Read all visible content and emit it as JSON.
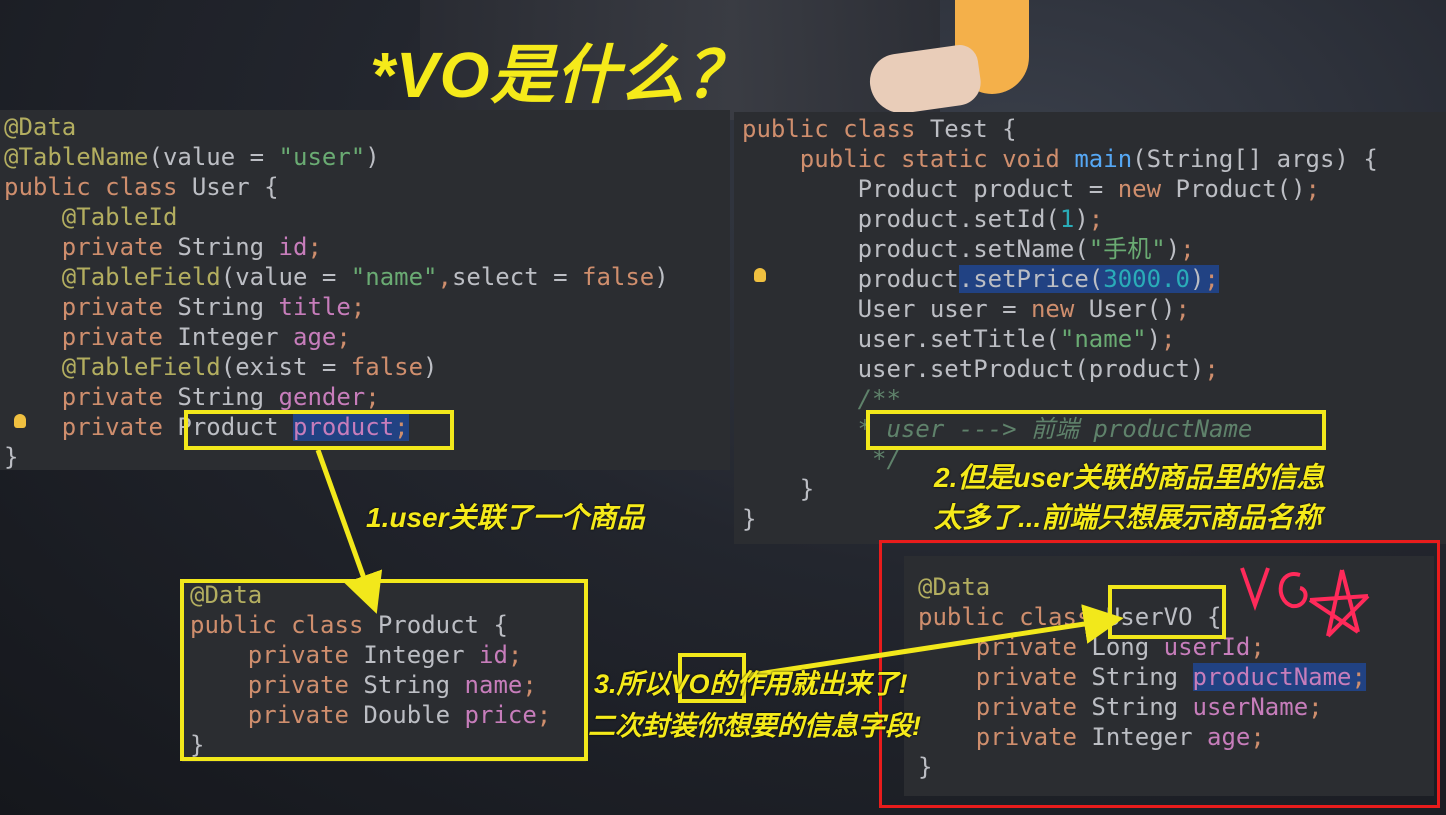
{
  "title": "*VO是什么？",
  "panel_user": {
    "lines": [
      [
        [
          "an",
          "@Data"
        ]
      ],
      [
        [
          "an",
          "@TableName"
        ],
        [
          "",
          "(value = "
        ],
        [
          "str",
          "\"user\""
        ],
        [
          "",
          ")"
        ]
      ],
      [
        [
          "kw",
          "public class"
        ],
        [
          "",
          " User {"
        ]
      ],
      [
        [
          "",
          ""
        ],
        [
          "an",
          "    @TableId"
        ]
      ],
      [
        [
          "kw",
          "    private"
        ],
        [
          "",
          " String "
        ],
        [
          "fld",
          "id"
        ],
        [
          "kw",
          ";"
        ]
      ],
      [
        [
          "an",
          "    @TableField"
        ],
        [
          "",
          "(value = "
        ],
        [
          "str",
          "\"name\""
        ],
        [
          "kw",
          ","
        ],
        [
          "",
          "select = "
        ],
        [
          "kw",
          "false"
        ],
        [
          "",
          ")"
        ]
      ],
      [
        [
          "kw",
          "    private"
        ],
        [
          "",
          " String "
        ],
        [
          "fld",
          "title"
        ],
        [
          "kw",
          ";"
        ]
      ],
      [
        [
          "kw",
          "    private"
        ],
        [
          "",
          " Integer "
        ],
        [
          "fld",
          "age"
        ],
        [
          "kw",
          ";"
        ]
      ],
      [
        [
          "an",
          "    @TableField"
        ],
        [
          "",
          "(exist = "
        ],
        [
          "kw",
          "false"
        ],
        [
          "",
          ")"
        ]
      ],
      [
        [
          "kw",
          "    private"
        ],
        [
          "",
          " String "
        ],
        [
          "fld",
          "gender"
        ],
        [
          "kw",
          ";"
        ]
      ],
      [
        [
          "kw",
          "    private"
        ],
        [
          "",
          " Product "
        ],
        [
          "fld sel",
          "product"
        ],
        [
          "kw sel",
          ";"
        ]
      ],
      [
        [
          "",
          "}"
        ]
      ]
    ]
  },
  "panel_test": {
    "lines": [
      [
        [
          "kw",
          "public class"
        ],
        [
          "",
          " Test {"
        ]
      ],
      [
        [
          "kw",
          "    public static void"
        ],
        [
          "",
          " "
        ],
        [
          "fn",
          "main"
        ],
        [
          "",
          "(String[] args) {"
        ]
      ],
      [
        [
          "",
          "        Product product = "
        ],
        [
          "kw",
          "new"
        ],
        [
          "",
          " Product()"
        ],
        [
          "kw",
          ";"
        ]
      ],
      [
        [
          "",
          "        product.setId("
        ],
        [
          "num",
          "1"
        ],
        [
          "",
          ")"
        ],
        [
          "kw",
          ";"
        ]
      ],
      [
        [
          "",
          "        product.setName("
        ],
        [
          "str",
          "\"手机\""
        ],
        [
          "",
          ")"
        ],
        [
          "kw",
          ";"
        ]
      ],
      [
        [
          "",
          "        product"
        ],
        [
          "sel",
          ".setPrice("
        ],
        [
          "num sel",
          "3000.0"
        ],
        [
          "sel",
          ")"
        ],
        [
          "kw sel",
          ";"
        ]
      ],
      [
        [
          "",
          "        User user = "
        ],
        [
          "kw",
          "new"
        ],
        [
          "",
          " User()"
        ],
        [
          "kw",
          ";"
        ]
      ],
      [
        [
          "",
          "        user.setTitle("
        ],
        [
          "str",
          "\"name\""
        ],
        [
          "",
          ")"
        ],
        [
          "kw",
          ";"
        ]
      ],
      [
        [
          "",
          "        user.setProduct(product)"
        ],
        [
          "kw",
          ";"
        ]
      ],
      [
        [
          "cm",
          "        /**"
        ]
      ],
      [
        [
          "cm",
          "        * user ---> "
        ],
        [
          "cm",
          "前端"
        ],
        [
          "cm",
          " productName"
        ]
      ],
      [
        [
          "cm",
          "         */"
        ]
      ],
      [
        [
          "",
          "    }"
        ]
      ],
      [
        [
          "",
          "}"
        ]
      ]
    ]
  },
  "panel_product": {
    "lines": [
      [
        [
          "an",
          "@Data"
        ]
      ],
      [
        [
          "kw",
          "public"
        ],
        [
          "kw",
          " class"
        ],
        [
          "",
          " Product {"
        ]
      ],
      [
        [
          "kw",
          "    private"
        ],
        [
          "",
          " Integer "
        ],
        [
          "fld",
          "id"
        ],
        [
          "kw",
          ";"
        ]
      ],
      [
        [
          "kw",
          "    private"
        ],
        [
          "",
          " String "
        ],
        [
          "fld",
          "name"
        ],
        [
          "kw",
          ";"
        ]
      ],
      [
        [
          "kw",
          "    private"
        ],
        [
          "",
          " Double "
        ],
        [
          "fld",
          "price"
        ],
        [
          "kw",
          ";"
        ]
      ],
      [
        [
          "",
          "}"
        ]
      ]
    ]
  },
  "panel_uservo": {
    "lines": [
      [
        [
          "an",
          "@Data"
        ]
      ],
      [
        [
          "kw",
          "public class"
        ],
        [
          "",
          " UserVO {"
        ]
      ],
      [
        [
          "kw",
          "    private"
        ],
        [
          "",
          " Long "
        ],
        [
          "fld",
          "userId"
        ],
        [
          "kw",
          ";"
        ]
      ],
      [
        [
          "kw",
          "    private"
        ],
        [
          "",
          " String "
        ],
        [
          "fld sel",
          "productName"
        ],
        [
          "kw sel",
          ";"
        ]
      ],
      [
        [
          "kw",
          "    private"
        ],
        [
          "",
          " String "
        ],
        [
          "fld",
          "userName"
        ],
        [
          "kw",
          ";"
        ]
      ],
      [
        [
          "kw",
          "    private"
        ],
        [
          "",
          " Integer "
        ],
        [
          "fld",
          "age"
        ],
        [
          "kw",
          ";"
        ]
      ],
      [
        [
          "",
          "}"
        ]
      ]
    ]
  },
  "annotations": {
    "note1": "1.user关联了一个商品",
    "note2_line1": "2.但是user关联的商品里的信息",
    "note2_line2": "太多了...前端只想展示商品名称",
    "note3_line1": "3.所以VO的作用就出来了!",
    "note3_line2": "二次封装你想要的信息字段!",
    "handwritten": "VO"
  },
  "colors": {
    "highlight_yellow": "#f2e81b",
    "note_yellow": "#f5ea1a",
    "red": "#e81c1c",
    "editor_bg": "#2b2d31"
  }
}
